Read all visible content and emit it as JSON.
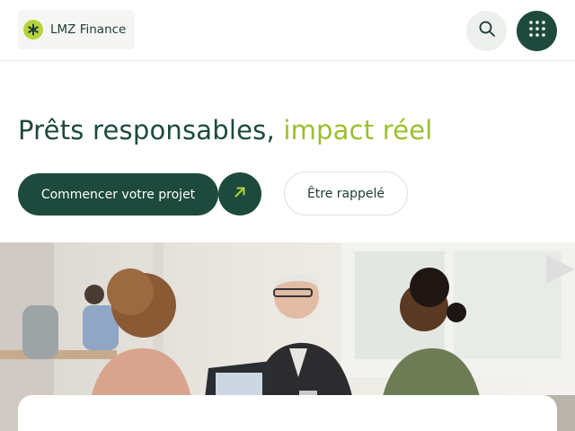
{
  "header": {
    "brand_name": "LMZ Finance",
    "logo_icon": "asterisk-icon",
    "search_icon": "search-icon",
    "menu_icon": "grid-menu-icon"
  },
  "hero": {
    "title_main": "Prêts responsables, ",
    "title_accent": "impact réel",
    "cta_label": "Commencer votre projet",
    "cta_icon": "arrow-up-right-icon",
    "callback_label": "Être rappelé"
  },
  "colors": {
    "primary": "#1d4a3c",
    "accent": "#9cbf2d",
    "logo_badge": "#b5d33a"
  }
}
